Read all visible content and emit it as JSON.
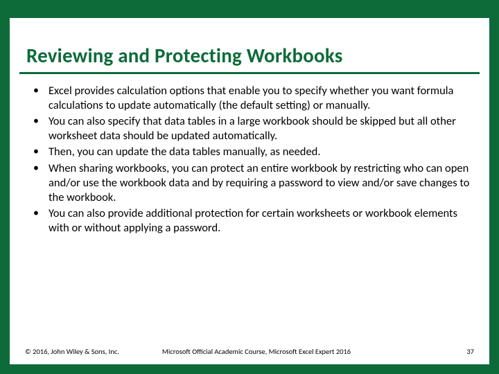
{
  "slide": {
    "title": "Reviewing and Protecting Workbooks",
    "bullets": [
      "Excel provides calculation options that enable you to specify whether you want formula calculations to update automatically (the default setting) or manually.",
      "You can also specify that data tables in a large workbook should be skipped but all other worksheet data should be updated automatically.",
      "Then, you can update the data tables manually, as needed.",
      "When sharing workbooks, you can protect an entire workbook by restricting who can open and/or use the workbook data and by requiring a password to view and/or save changes to the workbook.",
      "You can also provide additional protection for certain worksheets or workbook elements with or without applying a password."
    ],
    "footer": {
      "copyright": "© 2016, John Wiley & Sons, Inc.",
      "course": "Microsoft Official Academic Course, Microsoft Excel Expert 2016",
      "page": "37"
    }
  }
}
